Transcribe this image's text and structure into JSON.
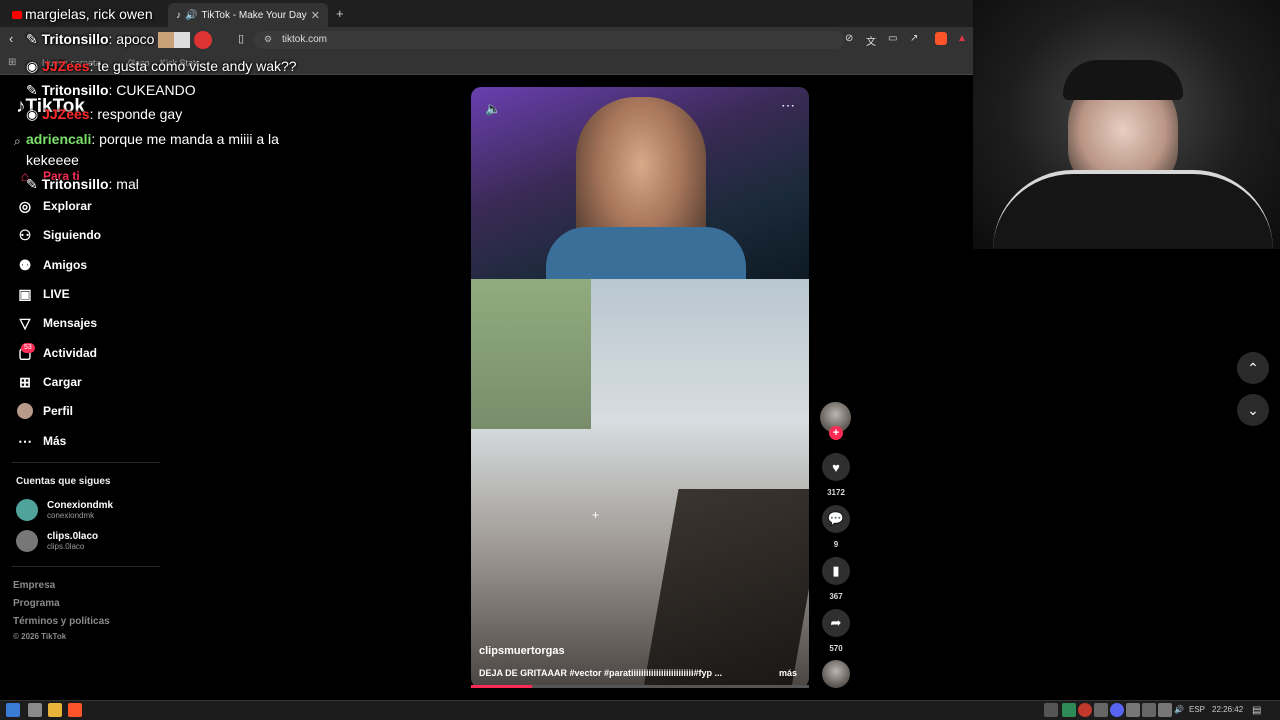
{
  "browser": {
    "tabs": [
      {
        "label": "margielas, rick owen"
      },
      {
        "label": "TikTok - Make Your Day"
      }
    ],
    "url": "tiktok.com",
    "bookmarks": [
      "Nueva carpeta",
      "0laco",
      "Kick Stats"
    ]
  },
  "tiktok": {
    "logo": "TikTok",
    "nav": [
      {
        "label": "Para ti",
        "icon": "home-icon"
      },
      {
        "label": "Explorar",
        "icon": "compass-icon"
      },
      {
        "label": "Siguiendo",
        "icon": "following-icon"
      },
      {
        "label": "Amigos",
        "icon": "friends-icon"
      },
      {
        "label": "LIVE",
        "icon": "live-icon"
      },
      {
        "label": "Mensajes",
        "icon": "messages-icon"
      },
      {
        "label": "Actividad",
        "icon": "activity-icon"
      },
      {
        "label": "Cargar",
        "icon": "upload-icon"
      },
      {
        "label": "Perfil",
        "icon": "profile-icon"
      },
      {
        "label": "Más",
        "icon": "more-icon"
      }
    ],
    "activity_badge": "53",
    "following_title": "Cuentas que sigues",
    "following": [
      {
        "name": "Conexiondmk",
        "handle": "conexiondmk",
        "color": "#4fa39a"
      },
      {
        "name": "clips.0laco",
        "handle": "clips.0laco",
        "color": "#777777"
      }
    ],
    "footer": [
      "Empresa",
      "Programa",
      "Términos y políticas",
      "© 2026 TikTok"
    ],
    "video": {
      "username": "clipsmuertorgas",
      "caption": "DEJA DE GRITAAAR #vector #paratiiiiiiiiiiiiiiiiiiiiiiiii#fyp ...",
      "more": "más",
      "progress": 0.18
    },
    "actions": {
      "likes": "3172",
      "comments": "9",
      "saves": "367",
      "shares": "570"
    },
    "accent": "#fe2c55"
  },
  "chat": [
    {
      "user": "Tritonsillo",
      "text": ": apoco",
      "color": "#ffffff"
    },
    {
      "user": "JJZees",
      "text": ": te gusta como viste andy wak??",
      "color": "#ff2a2a"
    },
    {
      "user": "Tritonsillo",
      "text": ": CUKEANDO",
      "color": "#ffffff"
    },
    {
      "user": "JJZees",
      "text": ": responde gay",
      "color": "#ff2a2a"
    },
    {
      "user": "adriencali",
      "text": ": porque me manda a miiii a la",
      "color": "#7be06a"
    },
    {
      "user": "",
      "text": "kekeeee",
      "color": "#ffffff"
    },
    {
      "user": "Tritonsillo",
      "text": ": mal",
      "color": "#ffffff"
    }
  ],
  "taskbar": {
    "lang": "ESP",
    "time": "22:26:42"
  }
}
